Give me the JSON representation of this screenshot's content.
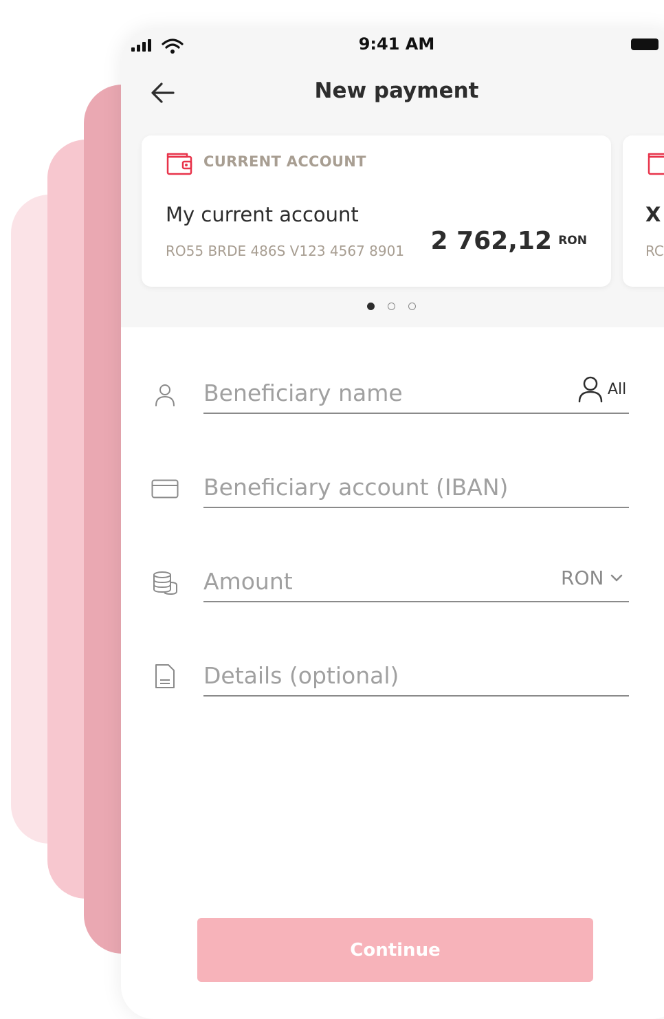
{
  "status_bar": {
    "time": "9:41 AM"
  },
  "nav": {
    "title": "New payment"
  },
  "accounts": [
    {
      "type": "CURRENT ACCOUNT",
      "name": "My current account",
      "iban": "RO55 BRDE 486S V123 4567 8901",
      "amount": "2 762,12",
      "currency": "RON"
    },
    {
      "name_visible": "X",
      "iban_visible": "RC"
    }
  ],
  "pager": {
    "total": 3,
    "active": 0
  },
  "form": {
    "beneficiary_name": {
      "placeholder": "Beneficiary name",
      "all_label": "All"
    },
    "beneficiary_account": {
      "placeholder": "Beneficiary account (IBAN)"
    },
    "amount": {
      "placeholder": "Amount",
      "currency": "RON"
    },
    "details": {
      "placeholder": "Details (optional)"
    }
  },
  "continue_label": "Continue",
  "colors": {
    "accent": "#e8334a",
    "button": "#f7b3ba",
    "muted": "#a89e92"
  }
}
